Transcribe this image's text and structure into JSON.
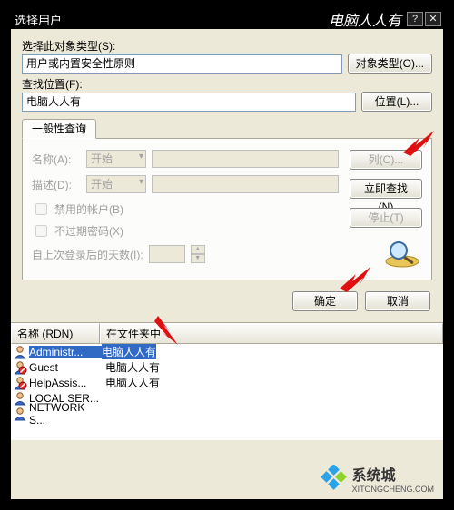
{
  "titlebar": {
    "title": "选择用户",
    "brand": "电脑人人有",
    "help": "?",
    "close": "✕"
  },
  "labels": {
    "object_type": "选择此对象类型(S):",
    "object_value": "用户或内置安全性原则",
    "object_types_btn": "对象类型(O)...",
    "location": "查找位置(F):",
    "location_value": "电脑人人有",
    "location_btn": "位置(L)...",
    "tab": "一般性查询",
    "name": "名称(A):",
    "desc": "描述(D):",
    "starts": "开始",
    "cb_disabled": "禁用的帐户(B)",
    "cb_noexpire": "不过期密码(X)",
    "days_since": "自上次登录后的天数(I):",
    "col_btn": "列(C)...",
    "findnow_btn": "立即查找(N)",
    "stop_btn": "停止(T)",
    "ok": "确定",
    "cancel": "取消"
  },
  "columns": {
    "rdn": "名称 (RDN)",
    "folder": "在文件夹中"
  },
  "rows": [
    {
      "name": "Administr...",
      "folder": "电脑人人有",
      "selected": true,
      "disabled": false
    },
    {
      "name": "Guest",
      "folder": "电脑人人有",
      "selected": false,
      "disabled": true
    },
    {
      "name": "HelpAssis...",
      "folder": "电脑人人有",
      "selected": false,
      "disabled": true
    },
    {
      "name": "LOCAL SER...",
      "folder": "",
      "selected": false,
      "disabled": false
    },
    {
      "name": "NETWORK S...",
      "folder": "",
      "selected": false,
      "disabled": false
    }
  ],
  "watermark": {
    "line1": "系统城",
    "line2": "XITONGCHENG.COM"
  }
}
